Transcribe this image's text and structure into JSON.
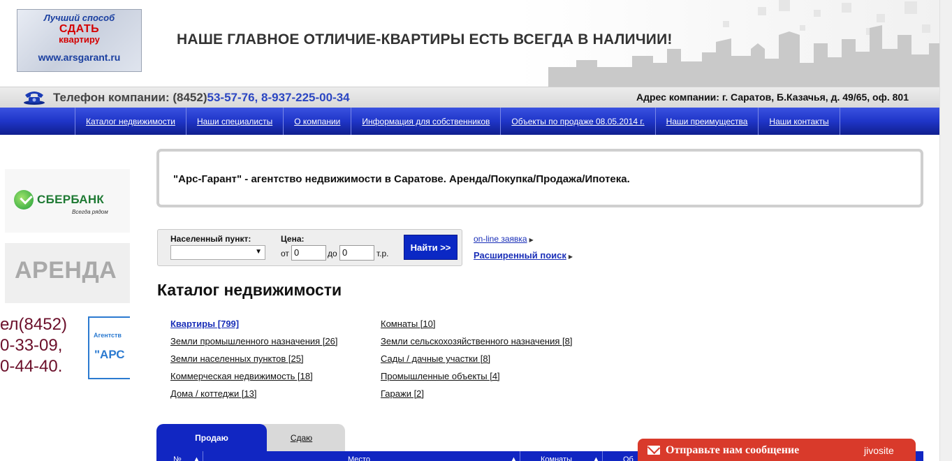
{
  "logo": {
    "line1": "Лучший способ",
    "line2": "СДАТЬ",
    "line3": "квартиру",
    "url": "www.arsgarant.ru"
  },
  "header": {
    "slogan": "НАШЕ ГЛАВНОЕ ОТЛИЧИЕ-КВАРТИРЫ ЕСТЬ ВСЕГДА В НАЛИЧИИ!"
  },
  "contact": {
    "phone_label": "Телефон компании: (8452)",
    "phone_numbers": "53-57-76, 8-937-225-00-34",
    "address": "Адрес компании: г. Саратов, Б.Казачья, д. 49/65, оф. 801"
  },
  "nav": {
    "items": [
      "Каталог недвижимости",
      "Наши специалисты",
      "О компании",
      "Информация для собственников",
      "Объекты по продаже 08.05.2014 г.",
      "Наши преимущества",
      "Наши контакты"
    ]
  },
  "banners": {
    "sber_name": "СБЕРБАНК",
    "sber_sub": "Всегда рядом",
    "arenda": "АРЕНДА",
    "phone_lines": [
      "ел(8452)",
      "0-33-09,",
      "0-44-40."
    ],
    "agency_line1": "Агентств",
    "agency_line2": "\"АРС"
  },
  "intro": {
    "text": "\"Арс-Гарант\" - агентство недвижимости в Саратове. Аренда/Покупка/Продажа/Ипотека."
  },
  "search": {
    "locality_label": "Населенный пункт:",
    "price_label": "Цена:",
    "from_label": "от",
    "to_label": "до",
    "unit_label": "т.р.",
    "from_value": "0",
    "to_value": "0",
    "button": "Найти >>",
    "online_link": "on-line заявка",
    "advanced_link": "Расширенный поиск"
  },
  "catalog": {
    "title": "Каталог недвижимости",
    "left": [
      "Квартиры [799]",
      "Земли промышленного назначения [26]",
      "Земли населенных пунктов [25]",
      "Коммерческая недвижимость [18]",
      "Дома / коттеджи [13]"
    ],
    "right": [
      "Комнаты [10]",
      "Земли сельскохозяйственного назначения [8]",
      "Сады / дачные участки [8]",
      "Промышленные объекты [4]",
      "Гаражи [2]"
    ]
  },
  "tabs": {
    "sell": "Продаю",
    "rent": "Сдаю"
  },
  "table": {
    "col_no": "№",
    "col_place": "Место",
    "col_rooms": "Комнаты",
    "col_area": "Об"
  },
  "chat": {
    "message": "Отправьте нам сообщение",
    "brand": "jivosite"
  },
  "colors": {
    "nav_blue": "#1f35c8",
    "link_blue": "#1a2fb8",
    "chat_red": "#d93a2b"
  }
}
